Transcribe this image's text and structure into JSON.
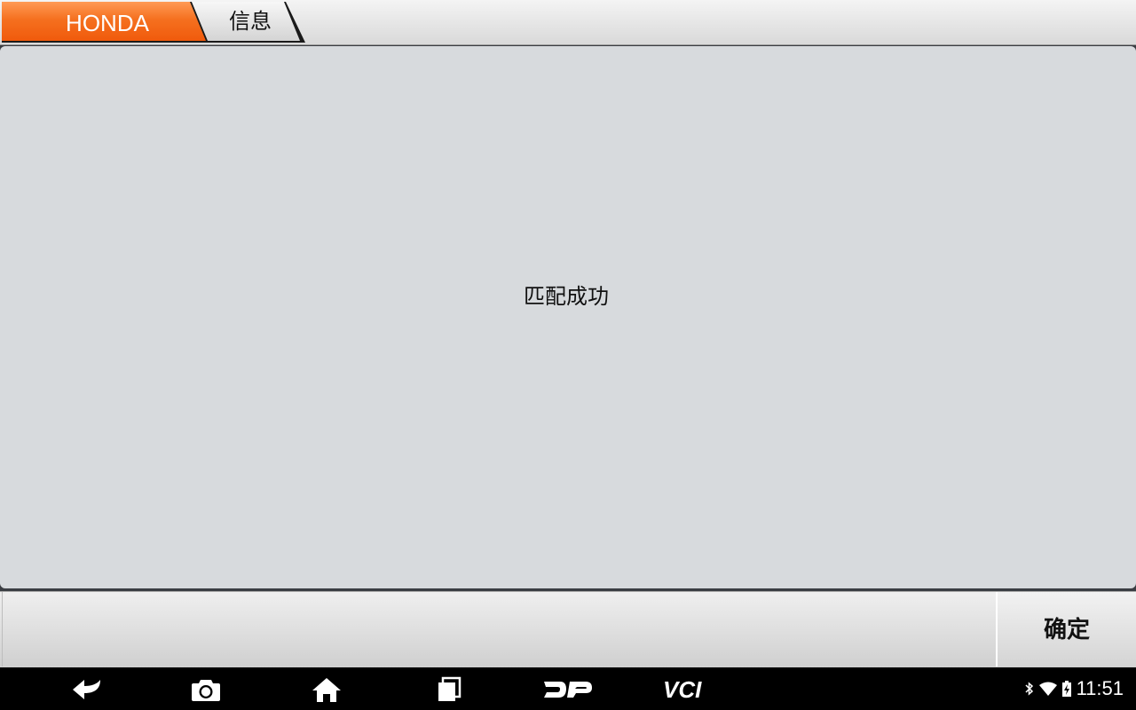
{
  "breadcrumb": {
    "brand": "HONDA",
    "page": "信息"
  },
  "main": {
    "message": "匹配成功"
  },
  "footer": {
    "confirm_label": "确定"
  },
  "navbar": {
    "icons": [
      "back-icon",
      "camera-icon",
      "home-icon",
      "recent-apps-icon",
      "dp-icon",
      "vci-icon"
    ],
    "vci_label": "VCI",
    "dp_label": "DP"
  },
  "status_bar": {
    "time": "11:51",
    "icons": [
      "bluetooth-icon",
      "wifi-icon",
      "battery-icon"
    ]
  },
  "colors": {
    "brand_orange": "#f26a1b",
    "panel_bg": "#d7dadd"
  }
}
